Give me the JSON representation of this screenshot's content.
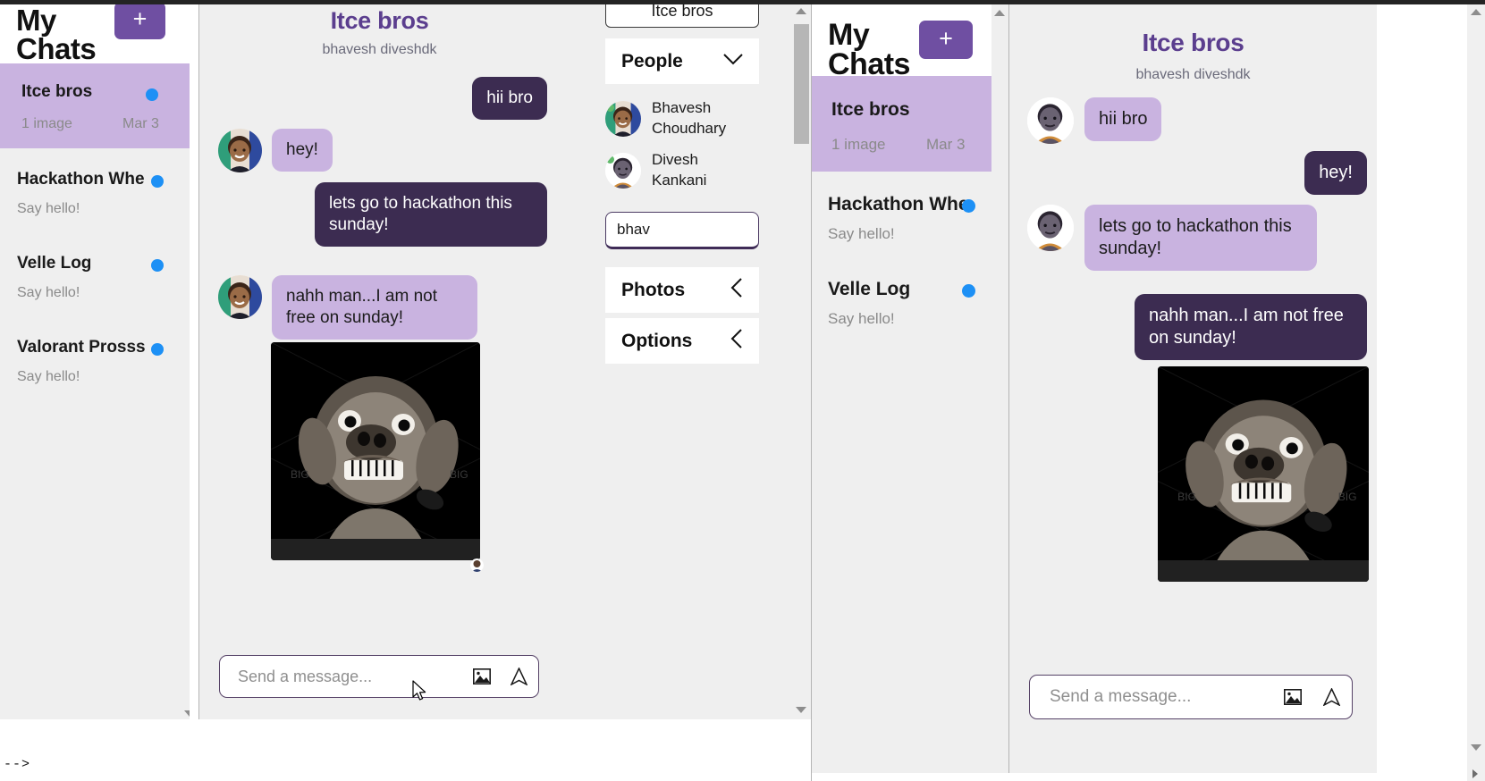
{
  "app": {
    "accent_purple": "#6f4fa2",
    "bubble_them": "#c9b3e0",
    "bubble_me": "#3c2c51",
    "unread_dot": "#1d90f5",
    "background": "#efefef"
  },
  "sidebar": {
    "title": "My Chats",
    "new_chat_label": "+",
    "items": [
      {
        "name": "Itce bros",
        "sub": "1 image",
        "date": "Mar 3",
        "unread": true,
        "active": true
      },
      {
        "name": "Hackathon Whe",
        "sub": "Say hello!",
        "date": "",
        "unread": true,
        "active": false
      },
      {
        "name": "Velle Log",
        "sub": "Say hello!",
        "date": "",
        "unread": true,
        "active": false
      },
      {
        "name": "Valorant Prosss",
        "sub": "Say hello!",
        "date": "",
        "unread": true,
        "active": false
      }
    ]
  },
  "chat": {
    "title": "Itce bros",
    "subtitle": "bhavesh diveshdk",
    "messages": [
      {
        "text": "hii bro",
        "side": "right",
        "kind": "text"
      },
      {
        "text": "hey!",
        "side": "left",
        "kind": "text"
      },
      {
        "text": "lets go to hackathon this sunday!",
        "side": "right",
        "kind": "text"
      },
      {
        "text": "nahh man...I am not free on sunday!",
        "side": "left",
        "kind": "text"
      },
      {
        "text": "",
        "side": "left",
        "kind": "image",
        "alt": "angry dog meme"
      }
    ],
    "composer": {
      "placeholder": "Send a message...",
      "value": "",
      "image_icon": "image-icon",
      "send_icon": "send-icon"
    }
  },
  "chat_mirror": {
    "title": "Itce bros",
    "subtitle": "bhavesh diveshdk",
    "messages": [
      {
        "text": "hii bro",
        "side": "left",
        "kind": "text"
      },
      {
        "text": "hey!",
        "side": "right",
        "kind": "text"
      },
      {
        "text": "lets go to hackathon this sunday!",
        "side": "left",
        "kind": "text"
      },
      {
        "text": "nahh man...I am not free on sunday!",
        "side": "right",
        "kind": "text"
      },
      {
        "text": "",
        "side": "right",
        "kind": "image",
        "alt": "angry dog meme"
      }
    ],
    "composer": {
      "placeholder": "Send a message...",
      "value": ""
    }
  },
  "details": {
    "tab_label": "Itce bros",
    "sections": [
      {
        "label": "People",
        "chevron": "chevron-down-icon",
        "expanded": true
      },
      {
        "label": "Photos",
        "chevron": "chevron-left-icon",
        "expanded": false
      },
      {
        "label": "Options",
        "chevron": "chevron-left-icon",
        "expanded": false
      }
    ],
    "people": [
      {
        "name": "Bhavesh Choudhary",
        "online": true
      },
      {
        "name": "Divesh Kankani",
        "online": true
      }
    ],
    "search": {
      "value": "bhav",
      "placeholder": ""
    }
  },
  "status": {
    "bottom_text": "-->"
  }
}
